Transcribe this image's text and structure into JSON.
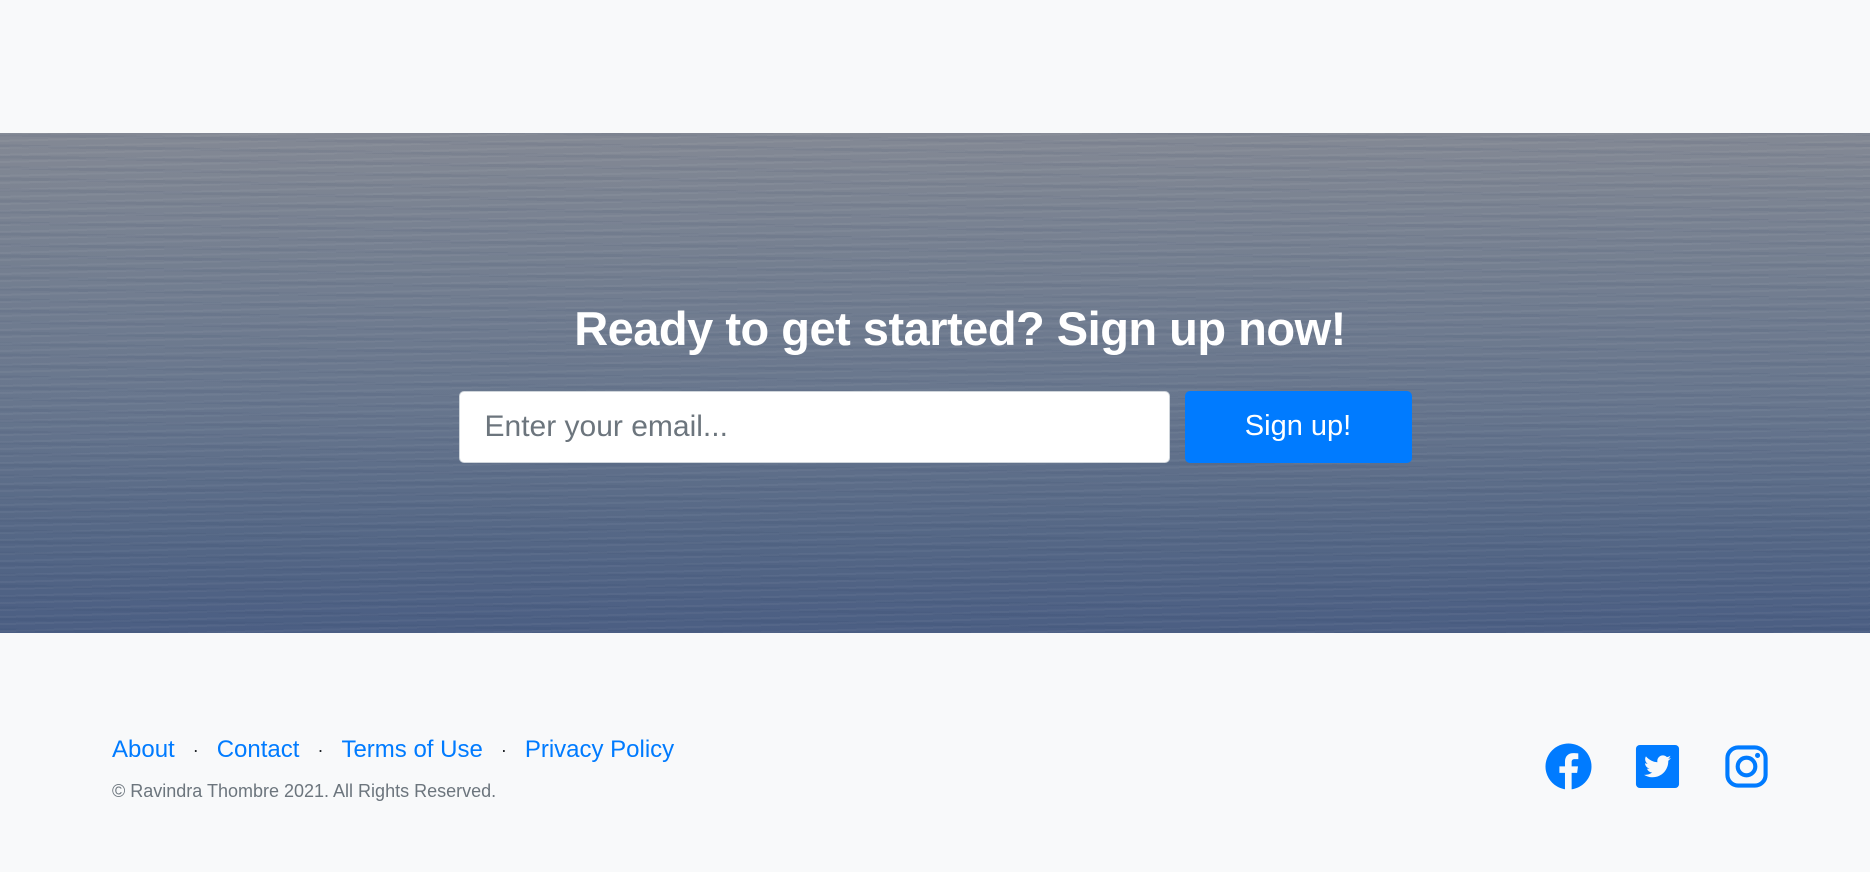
{
  "cta": {
    "title": "Ready to get started? Sign up now!",
    "email_placeholder": "Enter your email...",
    "email_value": "",
    "signup_label": "Sign up!"
  },
  "footer": {
    "links": [
      {
        "label": "About"
      },
      {
        "label": "Contact"
      },
      {
        "label": "Terms of Use"
      },
      {
        "label": "Privacy Policy"
      }
    ],
    "separator": "·",
    "copyright": "© Ravindra Thombre 2021. All Rights Reserved.",
    "social": [
      {
        "icon": "facebook-icon"
      },
      {
        "icon": "twitter-icon"
      },
      {
        "icon": "instagram-icon"
      }
    ]
  },
  "colors": {
    "accent": "#007bff",
    "background": "#f8f9fa",
    "muted_text": "#6c757d"
  }
}
